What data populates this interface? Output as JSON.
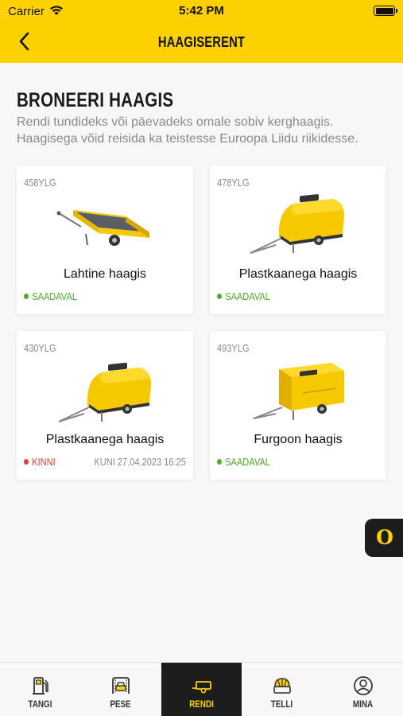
{
  "status_bar": {
    "carrier": "Carrier",
    "time": "5:42 PM"
  },
  "header": {
    "title": "HAAGISERENT",
    "back_icon": "chevron-left-icon"
  },
  "intro": {
    "heading": "BRONEERI HAAGIS",
    "description": "Rendi tundideks või päevadeks omale sobiv kerghaagis. Haagisega võid reisida ka teistesse Euroopa Liidu riikidesse."
  },
  "colors": {
    "accent": "#fdd000",
    "available": "#4caf2a",
    "unavailable": "#e53935",
    "dark": "#1d1d1d"
  },
  "trailers": [
    {
      "code": "458YLG",
      "name": "Lahtine haagis",
      "status": "SAADAVAL",
      "status_type": "available",
      "until": "",
      "image": "open-trailer-image"
    },
    {
      "code": "478YLG",
      "name": "Plastkaanega haagis",
      "status": "SAADAVAL",
      "status_type": "available",
      "until": "",
      "image": "covered-trailer-image"
    },
    {
      "code": "430YLG",
      "name": "Plastkaanega haagis",
      "status": "KINNI",
      "status_type": "unavailable",
      "until": "KUNI 27.04.2023 16:25",
      "image": "covered-trailer-image"
    },
    {
      "code": "493YLG",
      "name": "Furgoon haagis",
      "status": "SAADAVAL",
      "status_type": "available",
      "until": "",
      "image": "box-trailer-image"
    }
  ],
  "floating_button": {
    "label": "O",
    "icon": "olerex-logo-icon"
  },
  "tabs": [
    {
      "label": "TANGI",
      "icon": "fuel-pump-icon",
      "active": false
    },
    {
      "label": "PESE",
      "icon": "car-wash-icon",
      "active": false
    },
    {
      "label": "RENDI",
      "icon": "trailer-icon",
      "active": true
    },
    {
      "label": "TELLI",
      "icon": "order-icon",
      "active": false
    },
    {
      "label": "MINA",
      "icon": "user-icon",
      "active": false
    }
  ]
}
